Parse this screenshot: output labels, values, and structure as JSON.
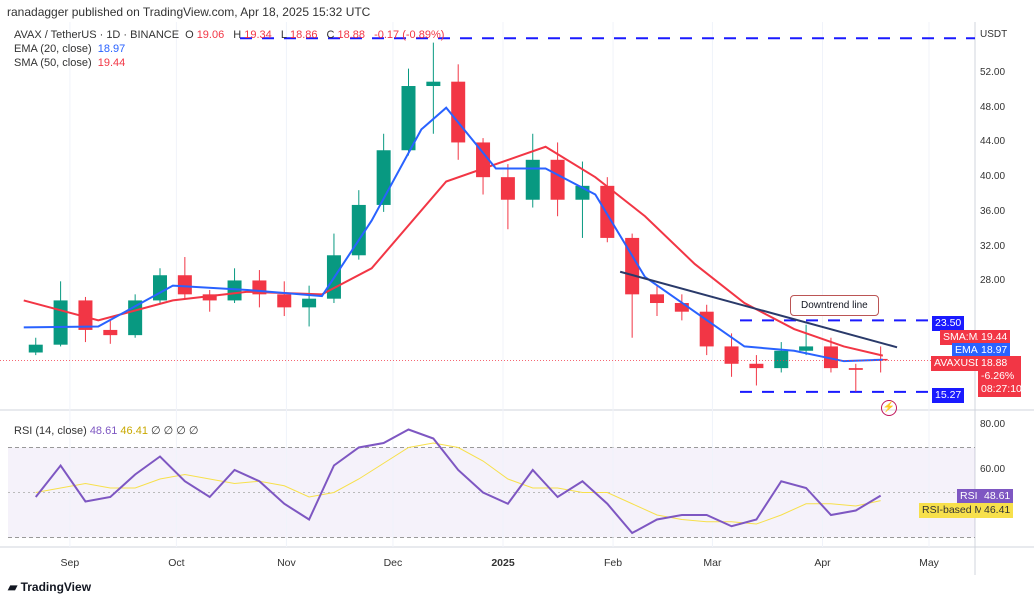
{
  "header": {
    "published": "ranadagger published on TradingView.com, Apr 18, 2025 15:32 UTC"
  },
  "legend": {
    "symbol": "AVAX / TetherUS · 1D · BINANCE",
    "o_label": "O",
    "o": "19.06",
    "h_label": "H",
    "h": "19.34",
    "l_label": "L",
    "l": "18.86",
    "c_label": "C",
    "c": "18.88",
    "change": "-0.17 (-0.89%)",
    "ema_label": "EMA (20, close)",
    "ema": "18.97",
    "sma_label": "SMA (50, close)",
    "sma": "19.44"
  },
  "axis": {
    "currency": "USDT",
    "price_ticks": [
      "52.00",
      "48.00",
      "44.00",
      "40.00",
      "36.00",
      "32.00",
      "28.00"
    ],
    "rsi_ticks": [
      "80.00",
      "60.00"
    ],
    "time_ticks": [
      "Sep",
      "Oct",
      "Nov",
      "Dec",
      "2025",
      "Feb",
      "Mar",
      "Apr",
      "May"
    ]
  },
  "tags": {
    "resistance": "23.50",
    "support": "15.27",
    "sma_name": "SMA:MA",
    "sma_val": "19.44",
    "ema_name": "EMA",
    "ema_val": "18.97",
    "sym_name": "AVAXUSDT",
    "sym_price": "18.88",
    "sym_change": "-6.26%",
    "countdown": "08:27:10",
    "rsi_name": "RSI",
    "rsi_val": "48.61",
    "rsima_name": "RSI-based MA",
    "rsima_val": "46.41"
  },
  "annotation": {
    "downtrend": "Downtrend line"
  },
  "rsi_legend": {
    "label": "RSI (14, close)",
    "rsi": "48.61",
    "ma": "46.41",
    "extra": "∅ ∅ ∅ ∅"
  },
  "footer": {
    "logo": "TradingView"
  },
  "colors": {
    "up": "#089981",
    "down": "#f23645",
    "ema": "#2962ff",
    "sma": "#f23645",
    "rsi": "#7e57c2",
    "rsi_ma": "#f7e04b",
    "levels": "#1a1aff",
    "trendline": "#2a3a6a"
  },
  "chart_data": {
    "type": "candlestick",
    "interval": "1D (summarised weekly)",
    "dates": [
      "2024-08-19",
      "2024-08-26",
      "2024-09-02",
      "2024-09-09",
      "2024-09-16",
      "2024-09-23",
      "2024-09-30",
      "2024-10-07",
      "2024-10-14",
      "2024-10-21",
      "2024-10-28",
      "2024-11-04",
      "2024-11-11",
      "2024-11-18",
      "2024-11-25",
      "2024-12-02",
      "2024-12-09",
      "2024-12-16",
      "2024-12-23",
      "2024-12-30",
      "2025-01-06",
      "2025-01-13",
      "2025-01-20",
      "2025-01-27",
      "2025-02-03",
      "2025-02-10",
      "2025-02-17",
      "2025-02-24",
      "2025-03-03",
      "2025-03-10",
      "2025-03-17",
      "2025-03-24",
      "2025-03-31",
      "2025-04-07",
      "2025-04-14"
    ],
    "ohlc": [
      [
        19.8,
        21.5,
        19.5,
        20.7
      ],
      [
        20.7,
        28.0,
        20.5,
        25.8
      ],
      [
        25.8,
        26.2,
        21.0,
        22.4
      ],
      [
        22.4,
        23.5,
        20.8,
        21.8
      ],
      [
        21.8,
        26.5,
        21.5,
        25.8
      ],
      [
        25.8,
        29.5,
        25.5,
        28.7
      ],
      [
        28.7,
        30.8,
        26.0,
        26.5
      ],
      [
        26.5,
        27.0,
        24.5,
        25.8
      ],
      [
        25.8,
        29.5,
        25.5,
        28.1
      ],
      [
        28.1,
        29.3,
        25.0,
        26.5
      ],
      [
        26.5,
        28.0,
        24.0,
        25.0
      ],
      [
        25.0,
        27.5,
        22.8,
        26.0
      ],
      [
        26.0,
        33.5,
        25.5,
        31.0
      ],
      [
        31.0,
        38.5,
        30.5,
        36.8
      ],
      [
        36.8,
        45.0,
        36.0,
        43.1
      ],
      [
        43.1,
        52.5,
        42.5,
        50.5
      ],
      [
        50.5,
        55.5,
        45.0,
        51.0
      ],
      [
        51.0,
        53.0,
        42.0,
        44.0
      ],
      [
        44.0,
        44.5,
        38.0,
        40.0
      ],
      [
        40.0,
        41.5,
        34.0,
        37.4
      ],
      [
        37.4,
        45.0,
        36.5,
        42.0
      ],
      [
        42.0,
        44.0,
        35.5,
        37.4
      ],
      [
        37.4,
        41.8,
        33.0,
        39.0
      ],
      [
        39.0,
        40.0,
        32.5,
        33.0
      ],
      [
        33.0,
        33.5,
        21.5,
        26.5
      ],
      [
        26.5,
        27.5,
        24.0,
        25.5
      ],
      [
        25.5,
        26.5,
        23.5,
        24.5
      ],
      [
        24.5,
        25.3,
        19.5,
        20.5
      ],
      [
        20.5,
        22.0,
        17.0,
        18.5
      ],
      [
        18.5,
        19.5,
        16.0,
        18.0
      ],
      [
        18.0,
        21.0,
        17.5,
        20.0
      ],
      [
        20.0,
        23.0,
        19.5,
        20.5
      ],
      [
        20.5,
        21.5,
        17.5,
        18.0
      ],
      [
        18.0,
        18.5,
        15.3,
        17.8
      ],
      [
        19.06,
        20.5,
        17.5,
        18.88
      ]
    ],
    "ema20": [
      [
        "2024-08-19",
        22.7
      ],
      [
        "2024-09-09",
        22.8
      ],
      [
        "2024-09-30",
        27.5
      ],
      [
        "2024-10-21",
        27.0
      ],
      [
        "2024-11-11",
        26.3
      ],
      [
        "2024-11-25",
        35.0
      ],
      [
        "2024-12-09",
        45.5
      ],
      [
        "2024-12-16",
        48.0
      ],
      [
        "2024-12-30",
        41.0
      ],
      [
        "2025-01-13",
        41.0
      ],
      [
        "2025-01-27",
        38.0
      ],
      [
        "2025-02-10",
        28.5
      ],
      [
        "2025-02-24",
        24.5
      ],
      [
        "2025-03-10",
        20.5
      ],
      [
        "2025-03-24",
        20.0
      ],
      [
        "2025-04-07",
        18.8
      ],
      [
        "2025-04-18",
        18.97
      ]
    ],
    "sma50": [
      [
        "2024-08-19",
        25.8
      ],
      [
        "2024-09-09",
        23.5
      ],
      [
        "2024-09-30",
        25.8
      ],
      [
        "2024-10-21",
        26.8
      ],
      [
        "2024-11-11",
        26.5
      ],
      [
        "2024-11-25",
        29.5
      ],
      [
        "2024-12-16",
        39.5
      ],
      [
        "2025-01-06",
        42.5
      ],
      [
        "2025-01-13",
        43.5
      ],
      [
        "2025-01-27",
        40.0
      ],
      [
        "2025-02-10",
        35.5
      ],
      [
        "2025-02-24",
        30.0
      ],
      [
        "2025-03-10",
        25.5
      ],
      [
        "2025-03-24",
        22.5
      ],
      [
        "2025-04-07",
        20.5
      ],
      [
        "2025-04-18",
        19.44
      ]
    ],
    "rsi": [
      48,
      62,
      46,
      48,
      58,
      66,
      55,
      48,
      60,
      55,
      45,
      38,
      62,
      70,
      72,
      78,
      74,
      60,
      50,
      45,
      60,
      48,
      55,
      45,
      32,
      38,
      40,
      40,
      35,
      38,
      55,
      52,
      40,
      42,
      48.61
    ],
    "rsi_ma": [
      50,
      52,
      54,
      52,
      52,
      56,
      58,
      56,
      54,
      55,
      53,
      48,
      50,
      56,
      63,
      70,
      72,
      70,
      64,
      56,
      52,
      52,
      50,
      50,
      45,
      40,
      38,
      37,
      37,
      36,
      40,
      45,
      45,
      44,
      46.41
    ],
    "levels": {
      "top": 56.0,
      "resistance": 23.5,
      "support": 15.27
    },
    "trendline": [
      [
        "2025-02-03",
        29.1
      ],
      [
        "2025-04-22",
        20.4
      ]
    ],
    "rsi_bands": [
      70,
      30
    ],
    "ylim": [
      14,
      57
    ]
  }
}
